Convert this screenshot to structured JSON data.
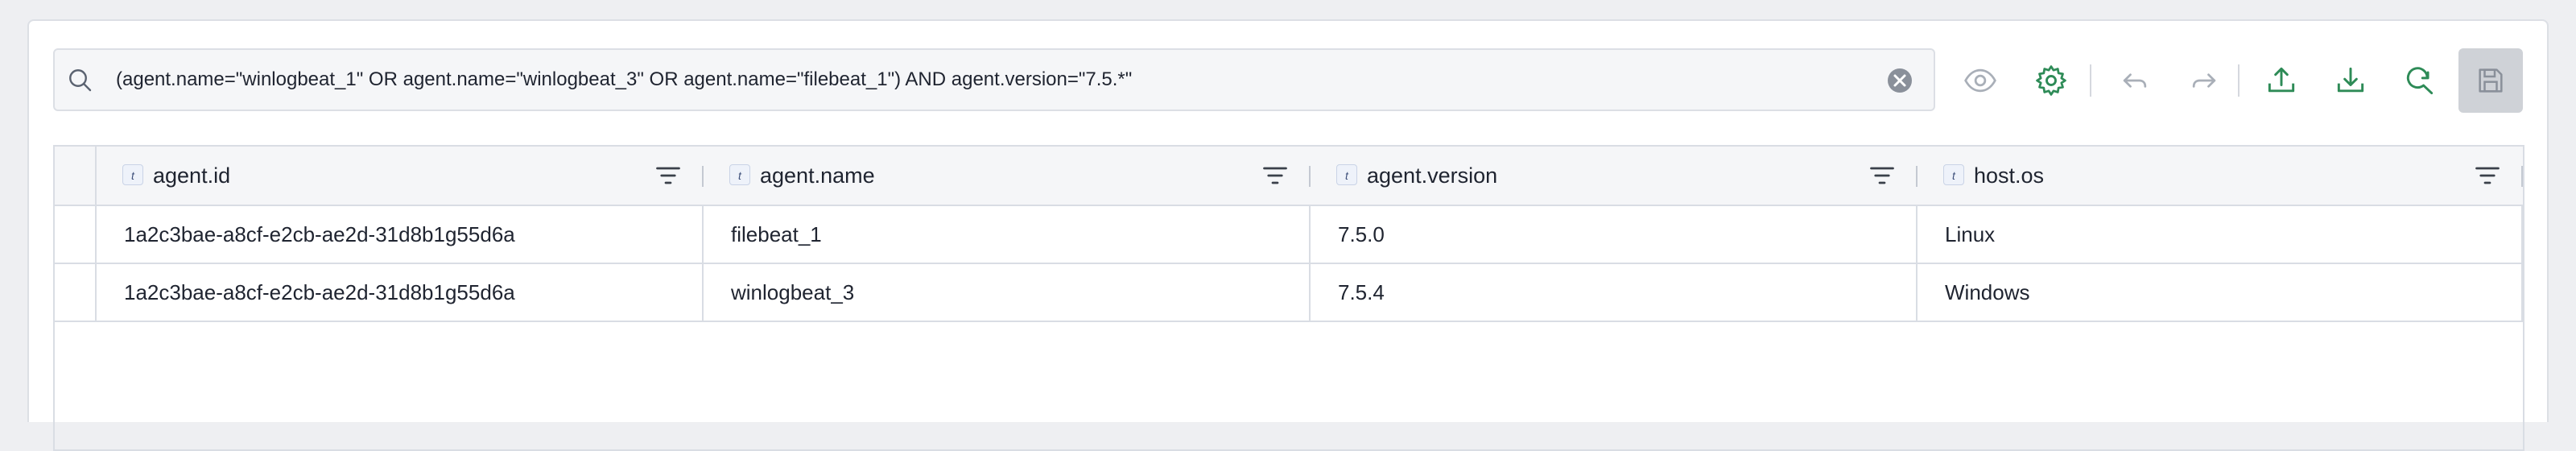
{
  "search": {
    "query": "(agent.name=\"winlogbeat_1\" OR agent.name=\"winlogbeat_3\" OR agent.name=\"filebeat_1\") AND agent.version=\"7.5.*\""
  },
  "toolbar": {
    "icons": [
      "eye-icon",
      "gear-icon",
      "undo-icon",
      "redo-icon",
      "upload-icon",
      "download-icon",
      "search-refresh-icon",
      "save-icon"
    ]
  },
  "grid": {
    "columns": [
      {
        "type": "t",
        "label": "agent.id"
      },
      {
        "type": "t",
        "label": "agent.name"
      },
      {
        "type": "t",
        "label": "agent.version"
      },
      {
        "type": "t",
        "label": "host.os"
      }
    ],
    "rows": [
      [
        "1a2c3bae-a8cf-e2cb-ae2d-31d8b1g55d6a",
        "filebeat_1",
        "7.5.0",
        "Linux"
      ],
      [
        "1a2c3bae-a8cf-e2cb-ae2d-31d8b1g55d6a",
        "winlogbeat_3",
        "7.5.4",
        "Windows"
      ]
    ]
  },
  "colors": {
    "accent": "#2e8b57",
    "muted_icon": "#a9afb8",
    "save_bg": "#cfd2d7"
  }
}
